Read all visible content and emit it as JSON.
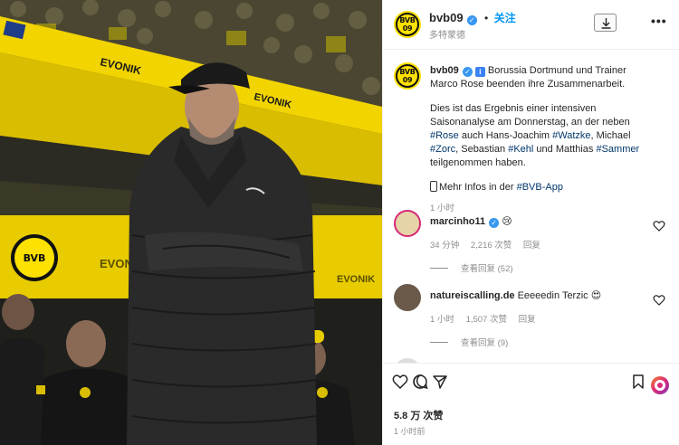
{
  "header": {
    "username": "bvb09",
    "follow_label": "关注",
    "separator": "•",
    "location": "多特蒙德",
    "avatar_text": "BVB 09"
  },
  "caption": {
    "username": "bvb09",
    "info_emoji": "ℹ️",
    "line1": "Borussia Dortmund und Trainer Marco Rose beenden ihre Zusammenarbeit.",
    "p2_a": "Dies ist das Ergebnis einer intensiven Saisonanalyse am Donnerstag, an der neben ",
    "tag_rose": "#Rose",
    "p2_b": " auch Hans-Joachim ",
    "tag_watzke": "#Watzke",
    "p2_c": ", Michael ",
    "tag_zorc": "#Zorc",
    "p2_d": ", Sebastian ",
    "tag_kehl": "#Kehl",
    "p2_e": " und Matthias ",
    "tag_sammer": "#Sammer",
    "p2_f": " teilgenommen haben.",
    "p3_a": "Mehr Infos in der ",
    "tag_app": "#BVB-App",
    "time": "1 小时"
  },
  "comments": [
    {
      "username": "marcinho11",
      "emoji": "😢",
      "time": "34 分钟",
      "likes": "2,216 次赞",
      "reply": "回复",
      "view_replies": "查看回复 (52)"
    },
    {
      "username": "natureiscalling.de",
      "text": "Eeeeedin Terzic",
      "emoji": "😍",
      "time": "1 小时",
      "likes": "1,507 次赞",
      "reply": "回复",
      "view_replies": "查看回复 (9)"
    }
  ],
  "actions": {
    "likes": "5.8 万 次赞",
    "time": "1 小时前"
  },
  "colors": {
    "accent": "#0095f6",
    "bvb_yellow": "#fde100",
    "verified": "#3897f0",
    "hashtag": "#00376b"
  }
}
